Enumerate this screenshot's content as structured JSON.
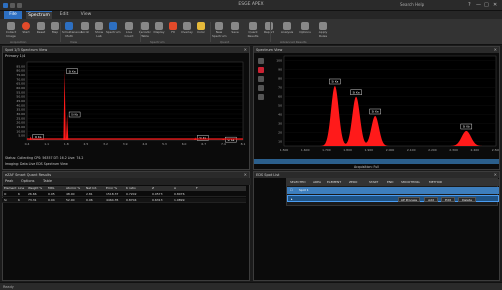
{
  "window": {
    "title": "ESGE APEX"
  },
  "titlebar": {
    "help": "Search Help",
    "controls": [
      "?",
      "—",
      "□",
      "✕"
    ]
  },
  "tabs": [
    "File",
    "Spectrum",
    "Edit",
    "View"
  ],
  "ribbon": {
    "buttons": [
      {
        "label": "Collect Image",
        "icon": "camera-icon",
        "color": "#888"
      },
      {
        "label": "Start",
        "icon": "record-icon",
        "color": "#e24a2a"
      },
      {
        "label": "Reset",
        "icon": "reset-icon",
        "color": "#888"
      },
      {
        "label": "Map",
        "icon": "map-icon",
        "color": "#888"
      },
      {
        "label": "Simultaneous Multi",
        "icon": "multi-icon",
        "color": "#2d6fc1"
      },
      {
        "label": "Scroll",
        "icon": "scroll-icon",
        "color": "#888"
      },
      {
        "label": "Show Lab",
        "icon": "lab-icon",
        "color": "#888"
      },
      {
        "label": "Spectrum",
        "icon": "spectrum-icon",
        "color": "#2d6fc1"
      },
      {
        "label": "Live Count",
        "icon": "count-icon",
        "color": "#888"
      },
      {
        "label": "Periodic Table",
        "icon": "periodic-icon",
        "color": "#888"
      },
      {
        "label": "Display",
        "icon": "display-icon",
        "color": "#888"
      },
      {
        "label": "Fit",
        "icon": "fit-icon",
        "color": "#e24a2a"
      },
      {
        "label": "Overlay",
        "icon": "overlay-icon",
        "color": "#888"
      },
      {
        "label": "Color",
        "icon": "palette-icon",
        "color": "#e5b93a"
      },
      {
        "label": "New Spectrum",
        "icon": "new-icon",
        "color": "#888"
      },
      {
        "label": "Save",
        "icon": "save-icon",
        "color": "#888"
      },
      {
        "label": "Quant Results",
        "icon": "results-icon",
        "color": "#888"
      },
      {
        "label": "Report",
        "icon": "report-icon",
        "color": "#888"
      },
      {
        "label": "Analysis",
        "icon": "analysis-icon",
        "color": "#888"
      },
      {
        "label": "Options",
        "icon": "options-icon",
        "color": "#888"
      },
      {
        "label": "Apply Rules",
        "icon": "rules-icon",
        "color": "#888"
      }
    ],
    "groups": [
      "Acquisition",
      "View",
      "Spectrum",
      "Quant",
      "Advanced Results"
    ]
  },
  "left_panel": {
    "title": "Spot 1/3 Spectrum View",
    "subtitle": "Primary 1/4",
    "footnote1": "Status: Collecting  CPS: 56357  DT: 16.2  Live: 74.2",
    "footnote2": "Imaging: Data    Live EDS Spectrum View"
  },
  "right_panel": {
    "title": "Spectrum View",
    "footnote": "Acquisition: Full"
  },
  "results_panel": {
    "title": "eZAF Smart Quant Results",
    "toolbar": [
      "Peak",
      "Options",
      "Table"
    ],
    "columns": [
      "Element",
      "Line",
      "Weight %",
      "MDL",
      "Atomic %",
      "Net Int.",
      "Error %",
      "K ratio",
      "Z",
      "A",
      "F"
    ],
    "rows": [
      [
        "O",
        "K",
        "26.66",
        "0.05",
        "48.00",
        "2.81",
        "1518.37",
        "0.7202",
        "0.0573",
        "0.8076"
      ],
      [
        "Si",
        "K",
        "73.31",
        "0.04",
        "52.00",
        "0.96",
        "4464.35",
        "0.8704",
        "0.6313",
        "1.0899"
      ]
    ]
  },
  "eds_panel": {
    "title": "EDS Spot List",
    "columns": [
      "SELECTED",
      "AREA",
      "ELEMENT",
      "ZERO",
      "START",
      "END",
      "SMOOTHING",
      "METHOD"
    ],
    "row1_label": "Spot 1",
    "row2_buttons": [
      "AP Process",
      "Add",
      "Edit",
      "Delete"
    ]
  },
  "status": {
    "text": "Ready"
  },
  "colors": {
    "accent": "#2d6fc1",
    "spectrum": "#ff1a1a"
  },
  "chart_data": [
    {
      "type": "line",
      "title": "",
      "ylim": [
        0,
        90
      ],
      "y_ticks": [
        "5.00",
        "10.00",
        "15.00",
        "20.00",
        "25.00",
        "30.00",
        "35.00",
        "40.00",
        "45.00",
        "50.00",
        "55.00",
        "60.00",
        "65.00",
        "70.00",
        "75.00",
        "80.00",
        "85.00"
      ],
      "x_ticks": [
        "0.4",
        "1.1",
        "1.8",
        "2.5",
        "3.2",
        "3.9",
        "4.6",
        "5.3",
        "6.0",
        "6.7",
        "7.4",
        "8.1"
      ],
      "peaks": [
        {
          "label": "Si Ka",
          "x": 1.74,
          "y": 80
        },
        {
          "label": "O Ka",
          "x": 0.53,
          "y": 4
        },
        {
          "label": "Si Kb",
          "x": 1.83,
          "y": 30
        },
        {
          "label": "Si Ka",
          "x": 6.4,
          "y": 3
        },
        {
          "label": "Si Ka",
          "x": 7.4,
          "y": 1
        }
      ]
    },
    {
      "type": "area",
      "title": "",
      "ylim": [
        0,
        150
      ],
      "y_ticks": [
        "100",
        "90",
        "80",
        "70",
        "60",
        "50",
        "40",
        "30",
        "20",
        "10"
      ],
      "x_ticks": [
        "1.500",
        "1.600",
        "1.700",
        "1.800",
        "1.900",
        "2.000",
        "2.100",
        "2.200",
        "2.300",
        "2.400",
        "2.500"
      ],
      "peaks": [
        {
          "label": "Si Ka",
          "x": 1.74,
          "y": 100
        },
        {
          "label": "Si Ka",
          "x": 1.84,
          "y": 82
        },
        {
          "label": "Si Ka",
          "x": 1.93,
          "y": 50
        },
        {
          "label": "Si Kb",
          "x": 2.36,
          "y": 25
        }
      ]
    }
  ]
}
